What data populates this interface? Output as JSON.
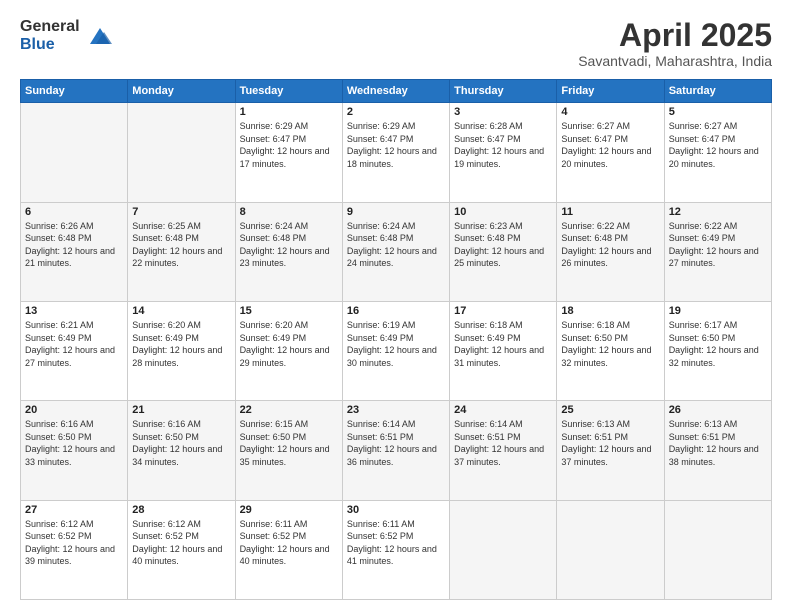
{
  "header": {
    "logo_general": "General",
    "logo_blue": "Blue",
    "title": "April 2025",
    "location": "Savantvadi, Maharashtra, India"
  },
  "days_of_week": [
    "Sunday",
    "Monday",
    "Tuesday",
    "Wednesday",
    "Thursday",
    "Friday",
    "Saturday"
  ],
  "weeks": [
    [
      {
        "day": "",
        "sunrise": "",
        "sunset": "",
        "daylight": ""
      },
      {
        "day": "",
        "sunrise": "",
        "sunset": "",
        "daylight": ""
      },
      {
        "day": "1",
        "sunrise": "Sunrise: 6:29 AM",
        "sunset": "Sunset: 6:47 PM",
        "daylight": "Daylight: 12 hours and 17 minutes."
      },
      {
        "day": "2",
        "sunrise": "Sunrise: 6:29 AM",
        "sunset": "Sunset: 6:47 PM",
        "daylight": "Daylight: 12 hours and 18 minutes."
      },
      {
        "day": "3",
        "sunrise": "Sunrise: 6:28 AM",
        "sunset": "Sunset: 6:47 PM",
        "daylight": "Daylight: 12 hours and 19 minutes."
      },
      {
        "day": "4",
        "sunrise": "Sunrise: 6:27 AM",
        "sunset": "Sunset: 6:47 PM",
        "daylight": "Daylight: 12 hours and 20 minutes."
      },
      {
        "day": "5",
        "sunrise": "Sunrise: 6:27 AM",
        "sunset": "Sunset: 6:47 PM",
        "daylight": "Daylight: 12 hours and 20 minutes."
      }
    ],
    [
      {
        "day": "6",
        "sunrise": "Sunrise: 6:26 AM",
        "sunset": "Sunset: 6:48 PM",
        "daylight": "Daylight: 12 hours and 21 minutes."
      },
      {
        "day": "7",
        "sunrise": "Sunrise: 6:25 AM",
        "sunset": "Sunset: 6:48 PM",
        "daylight": "Daylight: 12 hours and 22 minutes."
      },
      {
        "day": "8",
        "sunrise": "Sunrise: 6:24 AM",
        "sunset": "Sunset: 6:48 PM",
        "daylight": "Daylight: 12 hours and 23 minutes."
      },
      {
        "day": "9",
        "sunrise": "Sunrise: 6:24 AM",
        "sunset": "Sunset: 6:48 PM",
        "daylight": "Daylight: 12 hours and 24 minutes."
      },
      {
        "day": "10",
        "sunrise": "Sunrise: 6:23 AM",
        "sunset": "Sunset: 6:48 PM",
        "daylight": "Daylight: 12 hours and 25 minutes."
      },
      {
        "day": "11",
        "sunrise": "Sunrise: 6:22 AM",
        "sunset": "Sunset: 6:48 PM",
        "daylight": "Daylight: 12 hours and 26 minutes."
      },
      {
        "day": "12",
        "sunrise": "Sunrise: 6:22 AM",
        "sunset": "Sunset: 6:49 PM",
        "daylight": "Daylight: 12 hours and 27 minutes."
      }
    ],
    [
      {
        "day": "13",
        "sunrise": "Sunrise: 6:21 AM",
        "sunset": "Sunset: 6:49 PM",
        "daylight": "Daylight: 12 hours and 27 minutes."
      },
      {
        "day": "14",
        "sunrise": "Sunrise: 6:20 AM",
        "sunset": "Sunset: 6:49 PM",
        "daylight": "Daylight: 12 hours and 28 minutes."
      },
      {
        "day": "15",
        "sunrise": "Sunrise: 6:20 AM",
        "sunset": "Sunset: 6:49 PM",
        "daylight": "Daylight: 12 hours and 29 minutes."
      },
      {
        "day": "16",
        "sunrise": "Sunrise: 6:19 AM",
        "sunset": "Sunset: 6:49 PM",
        "daylight": "Daylight: 12 hours and 30 minutes."
      },
      {
        "day": "17",
        "sunrise": "Sunrise: 6:18 AM",
        "sunset": "Sunset: 6:49 PM",
        "daylight": "Daylight: 12 hours and 31 minutes."
      },
      {
        "day": "18",
        "sunrise": "Sunrise: 6:18 AM",
        "sunset": "Sunset: 6:50 PM",
        "daylight": "Daylight: 12 hours and 32 minutes."
      },
      {
        "day": "19",
        "sunrise": "Sunrise: 6:17 AM",
        "sunset": "Sunset: 6:50 PM",
        "daylight": "Daylight: 12 hours and 32 minutes."
      }
    ],
    [
      {
        "day": "20",
        "sunrise": "Sunrise: 6:16 AM",
        "sunset": "Sunset: 6:50 PM",
        "daylight": "Daylight: 12 hours and 33 minutes."
      },
      {
        "day": "21",
        "sunrise": "Sunrise: 6:16 AM",
        "sunset": "Sunset: 6:50 PM",
        "daylight": "Daylight: 12 hours and 34 minutes."
      },
      {
        "day": "22",
        "sunrise": "Sunrise: 6:15 AM",
        "sunset": "Sunset: 6:50 PM",
        "daylight": "Daylight: 12 hours and 35 minutes."
      },
      {
        "day": "23",
        "sunrise": "Sunrise: 6:14 AM",
        "sunset": "Sunset: 6:51 PM",
        "daylight": "Daylight: 12 hours and 36 minutes."
      },
      {
        "day": "24",
        "sunrise": "Sunrise: 6:14 AM",
        "sunset": "Sunset: 6:51 PM",
        "daylight": "Daylight: 12 hours and 37 minutes."
      },
      {
        "day": "25",
        "sunrise": "Sunrise: 6:13 AM",
        "sunset": "Sunset: 6:51 PM",
        "daylight": "Daylight: 12 hours and 37 minutes."
      },
      {
        "day": "26",
        "sunrise": "Sunrise: 6:13 AM",
        "sunset": "Sunset: 6:51 PM",
        "daylight": "Daylight: 12 hours and 38 minutes."
      }
    ],
    [
      {
        "day": "27",
        "sunrise": "Sunrise: 6:12 AM",
        "sunset": "Sunset: 6:52 PM",
        "daylight": "Daylight: 12 hours and 39 minutes."
      },
      {
        "day": "28",
        "sunrise": "Sunrise: 6:12 AM",
        "sunset": "Sunset: 6:52 PM",
        "daylight": "Daylight: 12 hours and 40 minutes."
      },
      {
        "day": "29",
        "sunrise": "Sunrise: 6:11 AM",
        "sunset": "Sunset: 6:52 PM",
        "daylight": "Daylight: 12 hours and 40 minutes."
      },
      {
        "day": "30",
        "sunrise": "Sunrise: 6:11 AM",
        "sunset": "Sunset: 6:52 PM",
        "daylight": "Daylight: 12 hours and 41 minutes."
      },
      {
        "day": "",
        "sunrise": "",
        "sunset": "",
        "daylight": ""
      },
      {
        "day": "",
        "sunrise": "",
        "sunset": "",
        "daylight": ""
      },
      {
        "day": "",
        "sunrise": "",
        "sunset": "",
        "daylight": ""
      }
    ]
  ]
}
